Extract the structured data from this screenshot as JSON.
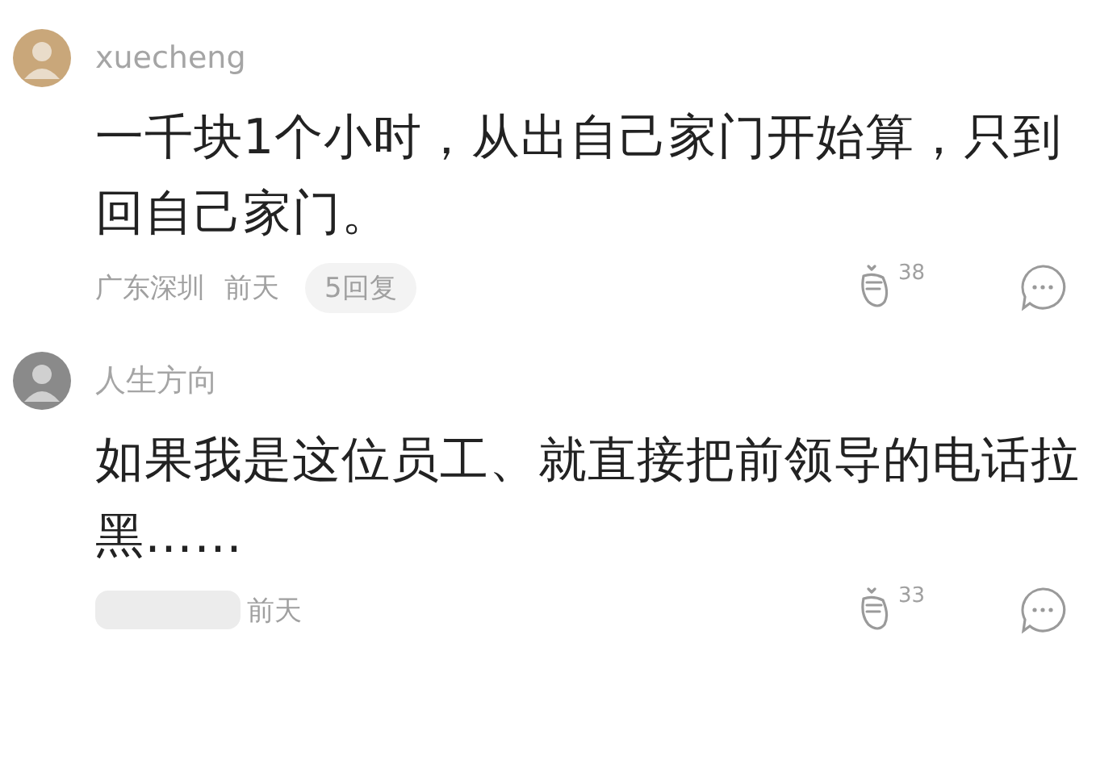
{
  "comments": [
    {
      "author": "xuecheng",
      "text": "一千块1个小时，从出自己家门开始算，只到回自己家门。",
      "location": "广东深圳",
      "time": "前天",
      "replies": "5回复",
      "likes": "38"
    },
    {
      "author": "人生方向",
      "text": "如果我是这位员工、就直接把前领导的电话拉黑……",
      "time": "前天",
      "likes": "33"
    }
  ]
}
